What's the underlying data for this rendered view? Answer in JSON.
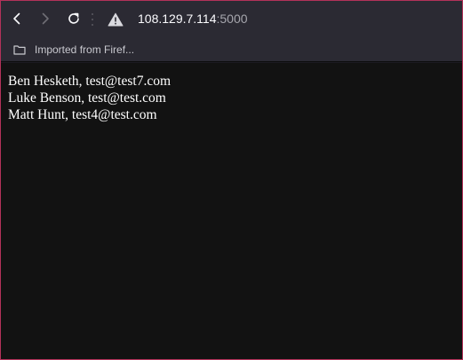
{
  "browser": {
    "url_host": "108.129.7.114",
    "url_port": ":5000",
    "bookmark_label": "Imported from Firef..."
  },
  "page": {
    "lines": [
      "Ben Hesketh, test@test7.com",
      "Luke Benson, test@test.com",
      "Matt Hunt, test4@test.com"
    ]
  },
  "colors": {
    "frame_accent": "#b3325a",
    "toolbar_bg": "#2b2a33",
    "page_bg": "#121212"
  }
}
